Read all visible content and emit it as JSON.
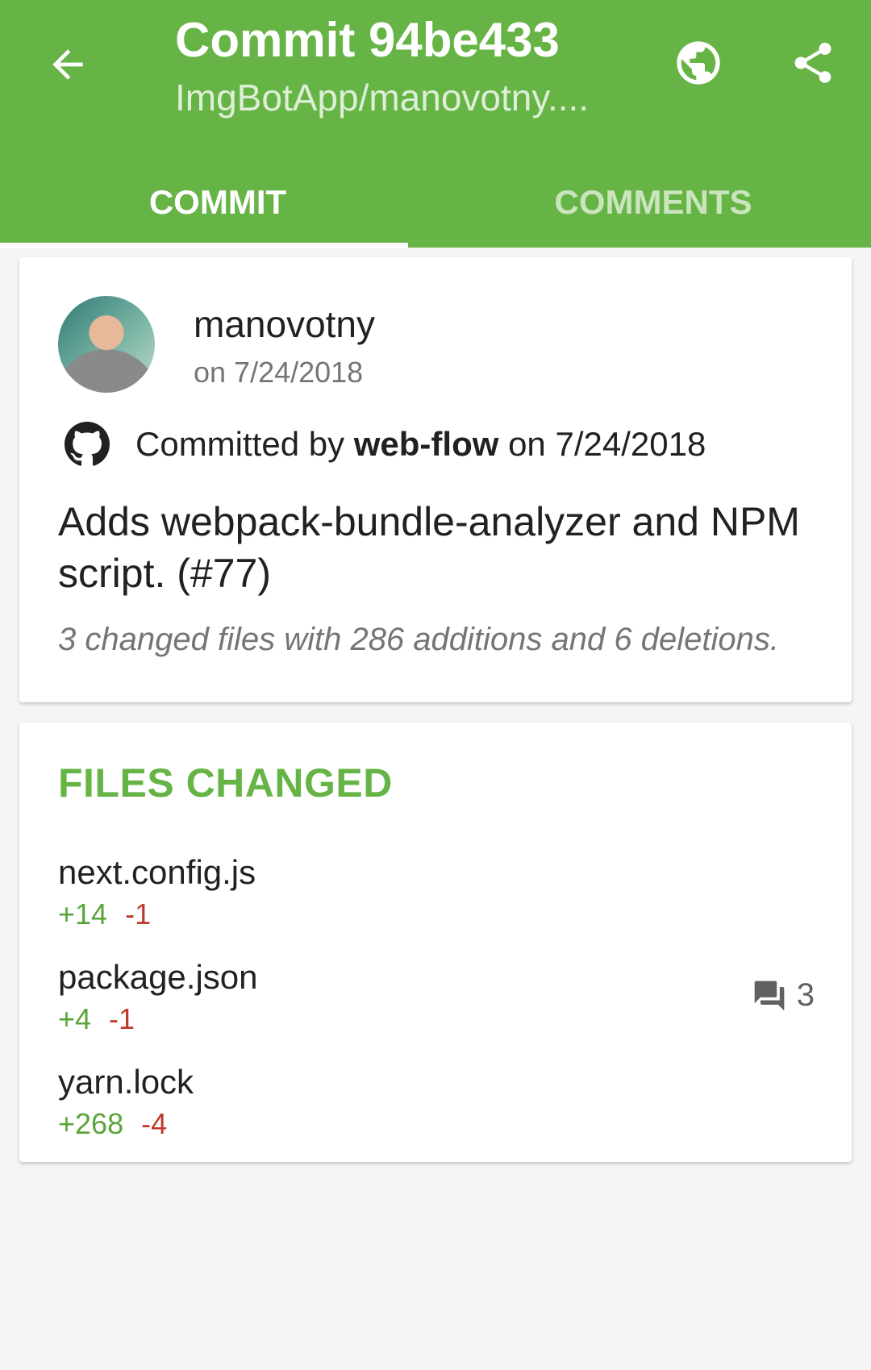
{
  "colors": {
    "accent": "#67b446",
    "additions": "#5aa53a",
    "deletions": "#c0392b"
  },
  "appbar": {
    "title": "Commit 94be433",
    "subtitle": "ImgBotApp/manovotny....",
    "icons": {
      "back": "arrow-back-icon",
      "browser": "globe-icon",
      "share": "share-icon"
    }
  },
  "tabs": [
    {
      "label": "COMMIT",
      "active": true
    },
    {
      "label": "COMMENTS",
      "active": false
    }
  ],
  "commit": {
    "author": "manovotny",
    "authored_on": "on 7/24/2018",
    "committed_prefix": "Committed by",
    "committer": "web-flow",
    "committed_on": "on 7/24/2018",
    "message": "Adds webpack-bundle-analyzer and NPM script. (#77)",
    "summary": "3 changed files with 286 additions and 6 deletions."
  },
  "files_changed": {
    "title": "FILES CHANGED",
    "files": [
      {
        "name": "next.config.js",
        "additions": "+14",
        "deletions": "-1"
      },
      {
        "name": "package.json",
        "additions": "+4",
        "deletions": "-1",
        "comments": "3"
      },
      {
        "name": "yarn.lock",
        "additions": "+268",
        "deletions": "-4"
      }
    ]
  }
}
